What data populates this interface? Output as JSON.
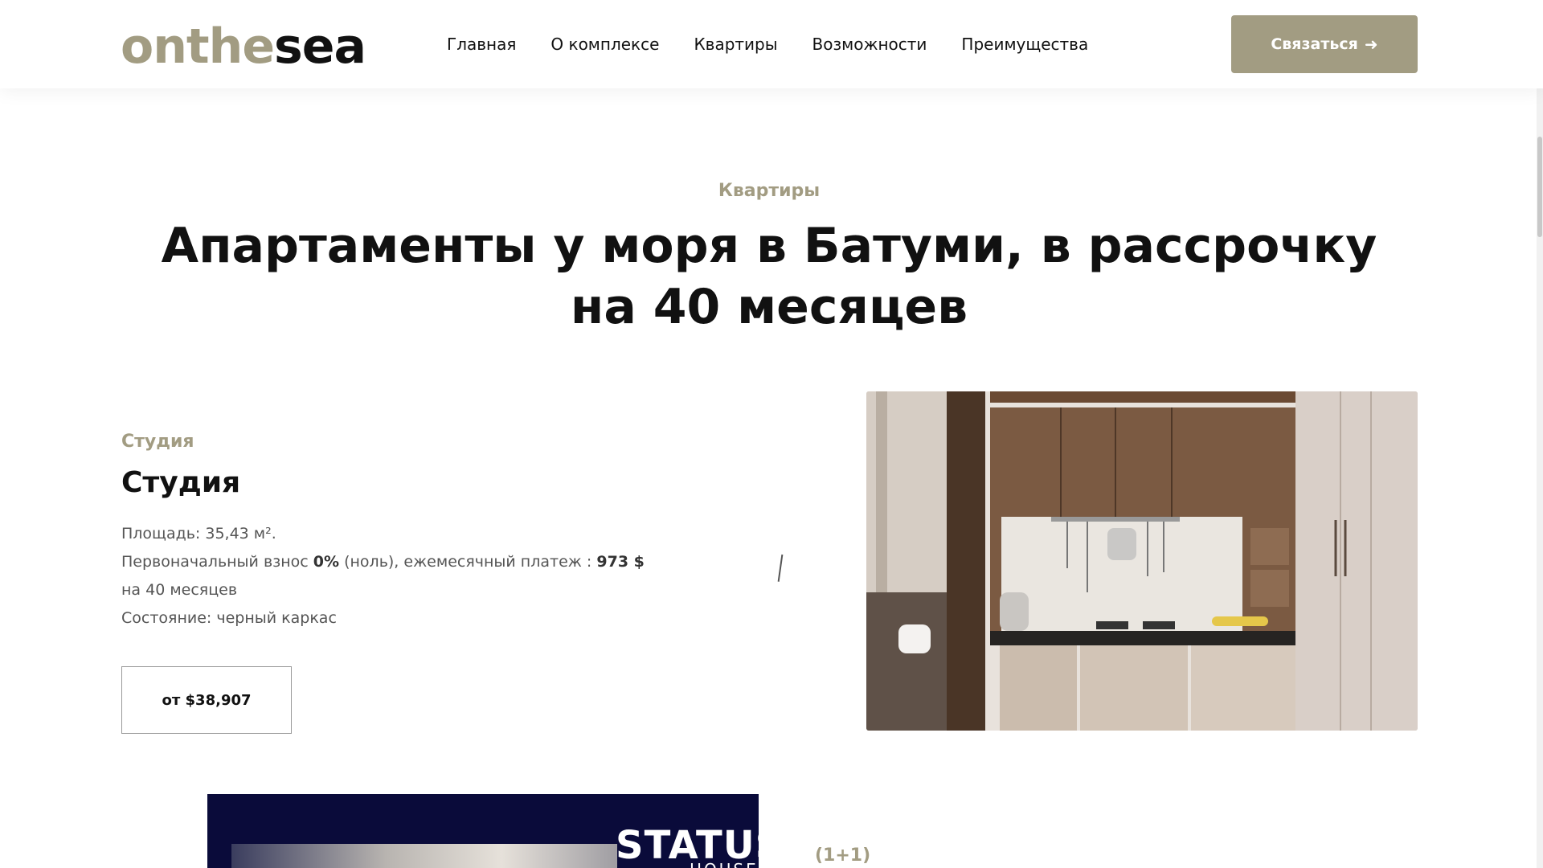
{
  "header": {
    "logo_part1": "onthe",
    "logo_part2": "sea",
    "nav": [
      "Главная",
      "О комплексе",
      "Квартиры",
      "Возможности",
      "Преимущества"
    ],
    "cta_label": "Связаться",
    "cta_arrow": "➜"
  },
  "section": {
    "kicker": "Квартиры",
    "title": "Апартаменты у моря в Батуми, в рассрочку на 40 месяцев"
  },
  "apartment": {
    "category": "Студия",
    "name": "Студия",
    "area": "Площадь: 35,43 м².",
    "payment_prefix": "Первоначальный взнос ",
    "payment_percent": "0%",
    "payment_mid": " (ноль), ежемесячный платеж : ",
    "payment_amount": "973 $",
    "term": "на 40 месяцев",
    "condition": "Состояние: черный каркас",
    "price_button": "от $38,907"
  },
  "next_card": {
    "brand_top": "STATUS",
    "brand_bottom": "HOUSE",
    "label": "(1+1)"
  },
  "colors": {
    "accent": "#a29c82",
    "text": "#111111",
    "muted": "#555555",
    "card_bg": "#0a0b3a"
  },
  "icons": {
    "cta_arrow": "arrow-right-icon"
  }
}
